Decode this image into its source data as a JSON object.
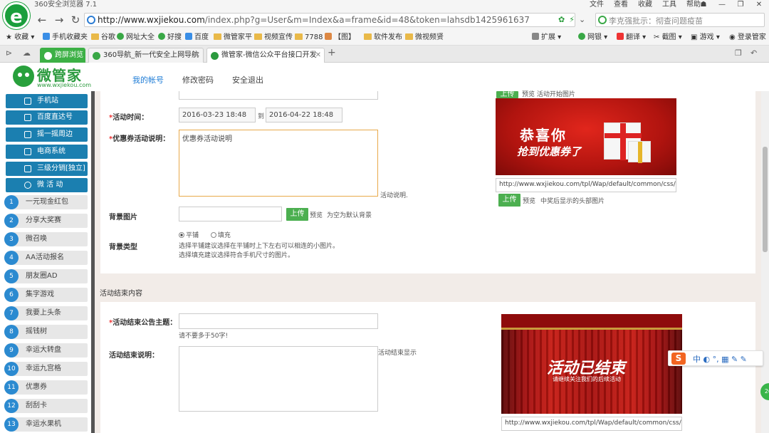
{
  "browser": {
    "title": "360安全浏览器 7.1",
    "menu": [
      "文件",
      "查看",
      "收藏",
      "工具",
      "帮助"
    ],
    "url_host": "http://www.wxjiekou.com",
    "url_path": "/index.php?g=User&m=Index&a=frame&id=48&token=lahsdb1425961637",
    "search_placeholder": "李克强批示：彻查问题疫苗",
    "bookmarks": [
      "收藏",
      "手机收藏夹",
      "谷歌",
      "网址大全",
      "好搜",
      "百度",
      "微管家平",
      "视频宣传",
      "7788",
      "【图】",
      "软件发布",
      "微视频贤"
    ],
    "right_tools": [
      "扩展",
      "网银",
      "翻译",
      "截图",
      "游戏",
      "登录管家"
    ],
    "tabs": [
      {
        "label": "跨屏浏览"
      },
      {
        "label": "360导航_新一代安全上网导航"
      },
      {
        "label": "微管家-微信公众平台接口开发"
      }
    ]
  },
  "site": {
    "logo_cn": "微管家",
    "logo_url": "www.wxjiekou.com",
    "nav": [
      "我的帐号",
      "修改密码",
      "安全退出"
    ]
  },
  "sidebar": {
    "sections": [
      "手机站",
      "百度直达号",
      "摇一摇周边",
      "电商系统",
      "三级分销[独立]",
      "微 活 动"
    ],
    "items": [
      {
        "num": "1",
        "label": "一元现金红包"
      },
      {
        "num": "2",
        "label": "分享大奖赛"
      },
      {
        "num": "3",
        "label": "微召唤"
      },
      {
        "num": "4",
        "label": "AA活动报名"
      },
      {
        "num": "5",
        "label": "朋友圈AD"
      },
      {
        "num": "6",
        "label": "集字游戏"
      },
      {
        "num": "7",
        "label": "我要上头条"
      },
      {
        "num": "8",
        "label": "摇钱树"
      },
      {
        "num": "9",
        "label": "幸运大转盘"
      },
      {
        "num": "10",
        "label": "幸运九宫格"
      },
      {
        "num": "11",
        "label": "优惠券"
      },
      {
        "num": "12",
        "label": "刮刮卡"
      },
      {
        "num": "13",
        "label": "幸运水果机"
      }
    ]
  },
  "form": {
    "activity_time_label": "活动时间：",
    "start_date": "2016-03-23 18:48",
    "to": "到",
    "end_date": "2016-04-22 18:48",
    "coupon_desc_label": "优惠券活动说明：",
    "coupon_desc_value": "优惠券活动说明",
    "coupon_desc_hint": "活动说明.",
    "bg_image_label": "背景图片",
    "upload": "上传",
    "preview": "预览",
    "bg_hint": "为空为默认背景",
    "bg_type_label": "背景类型",
    "bg_type_options": [
      "平铺",
      "填充"
    ],
    "bg_type_help1": "选择平铺建议选择在平铺时上下左右可以相连的小图片。",
    "bg_type_help2": "选择填充建议选择符合手机尺寸的图片。",
    "right_upload_top": "上传",
    "right_preview_top": "预览 活动开始图片",
    "banner1_text1": "恭喜你",
    "banner1_text2": "抢到优惠券了",
    "banner1_url": "http://www.wxjiekou.com/tpl/Wap/default/common/css/",
    "right_upload2": "上传",
    "right_preview2": "预览",
    "right_hint2": "中奖后显示的头部图片",
    "end_section_title": "活动结束内容",
    "end_title_label": "活动结束公告主题：",
    "end_title_hint": "请不要多于50字!",
    "end_desc_label": "活动结束说明：",
    "end_desc_hint": "活动结束显示",
    "banner2_text1": "活动已结束",
    "banner2_text2": "请继续关注我们的后续活动",
    "banner2_url": "http://www.wxjiekou.com/tpl/Wap/default/common/css/"
  },
  "ime": {
    "logo": "S",
    "text": "中 ◐ °, ▦ ✎ ✎"
  },
  "badge": "26"
}
